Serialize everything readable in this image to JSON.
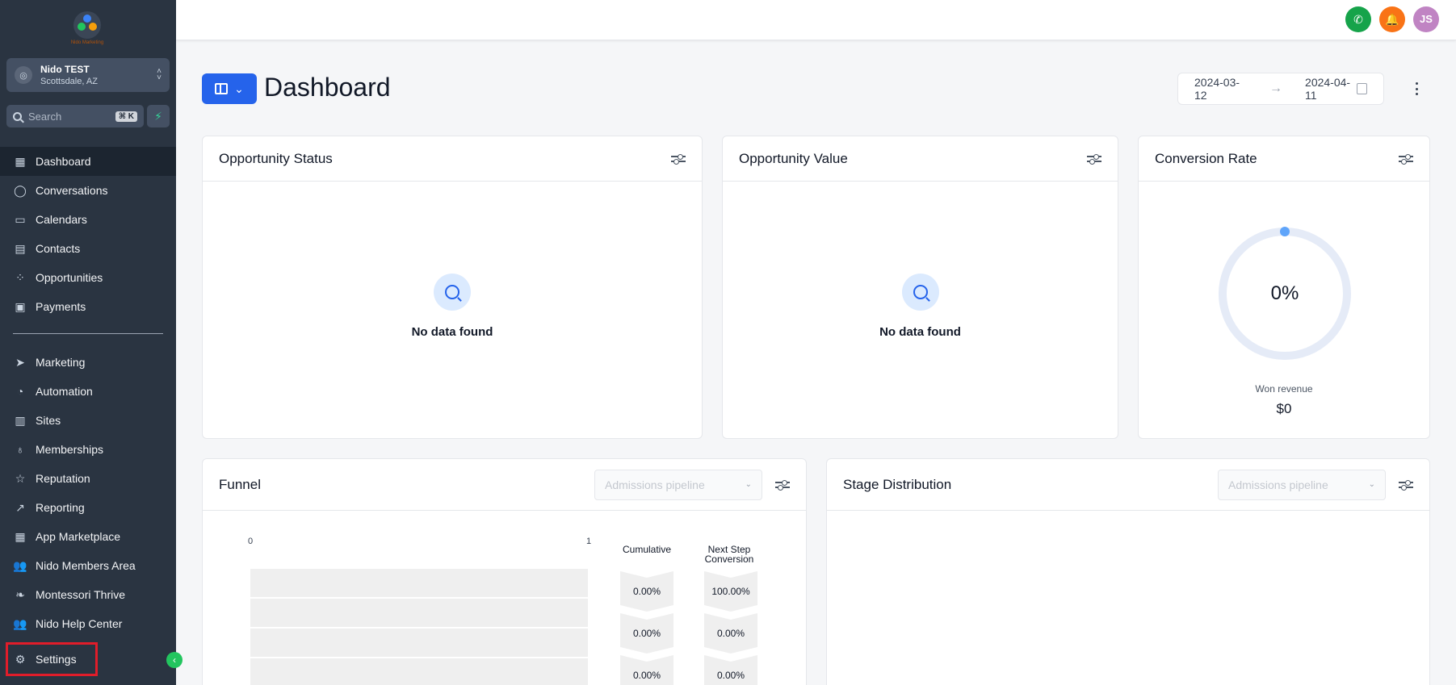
{
  "sidebar": {
    "logo_text": "Nido Marketing",
    "account": {
      "name": "Nido TEST",
      "location": "Scottsdale, AZ"
    },
    "search": {
      "placeholder": "Search",
      "shortcut": "⌘ K"
    },
    "items": [
      {
        "label": "Dashboard",
        "icon": "grid-icon",
        "active": true
      },
      {
        "label": "Conversations",
        "icon": "chat-icon"
      },
      {
        "label": "Calendars",
        "icon": "calendar-icon"
      },
      {
        "label": "Contacts",
        "icon": "contacts-icon"
      },
      {
        "label": "Opportunities",
        "icon": "opportunities-icon"
      },
      {
        "label": "Payments",
        "icon": "payments-icon"
      },
      {
        "label": "Marketing",
        "icon": "send-icon"
      },
      {
        "label": "Automation",
        "icon": "automation-icon"
      },
      {
        "label": "Sites",
        "icon": "sites-icon"
      },
      {
        "label": "Memberships",
        "icon": "membership-icon"
      },
      {
        "label": "Reputation",
        "icon": "star-icon"
      },
      {
        "label": "Reporting",
        "icon": "trend-icon"
      },
      {
        "label": "App Marketplace",
        "icon": "apps-icon"
      },
      {
        "label": "Nido Members Area",
        "icon": "users-icon"
      },
      {
        "label": "Montessori Thrive",
        "icon": "leaf-icon"
      },
      {
        "label": "Nido Help Center",
        "icon": "users-icon"
      },
      {
        "label": "Settings",
        "icon": "gear-icon"
      }
    ]
  },
  "topbar": {
    "avatar_initials": "JS",
    "colors": {
      "phone": "#16a34a",
      "bell": "#f97316",
      "avatar": "#c084c3"
    }
  },
  "header": {
    "title": "Dashboard",
    "date_start": "2024-03-12",
    "date_end": "2024-04-11"
  },
  "cards": {
    "opportunity_status": {
      "title": "Opportunity Status",
      "empty_text": "No data found"
    },
    "opportunity_value": {
      "title": "Opportunity Value",
      "empty_text": "No data found"
    },
    "conversion_rate": {
      "title": "Conversion Rate",
      "value": "0%",
      "won_label": "Won revenue",
      "won_value": "$0"
    },
    "funnel": {
      "title": "Funnel",
      "pipeline_placeholder": "Admissions pipeline",
      "axis_min": "0",
      "axis_max": "1",
      "cumulative_title": "Cumulative",
      "next_step_title": "Next Step Conversion",
      "cumulative": [
        "0.00%",
        "0.00%",
        "0.00%"
      ],
      "next_step": [
        "100.00%",
        "0.00%",
        "0.00%"
      ]
    },
    "stage_distribution": {
      "title": "Stage Distribution",
      "pipeline_placeholder": "Admissions pipeline"
    }
  },
  "colors": {
    "sidebar_bg": "#2a3441",
    "accent": "#2563eb",
    "highlight": "#e11d2a",
    "ring": "#e5ebf7",
    "ring_dot": "#60a5fa"
  }
}
